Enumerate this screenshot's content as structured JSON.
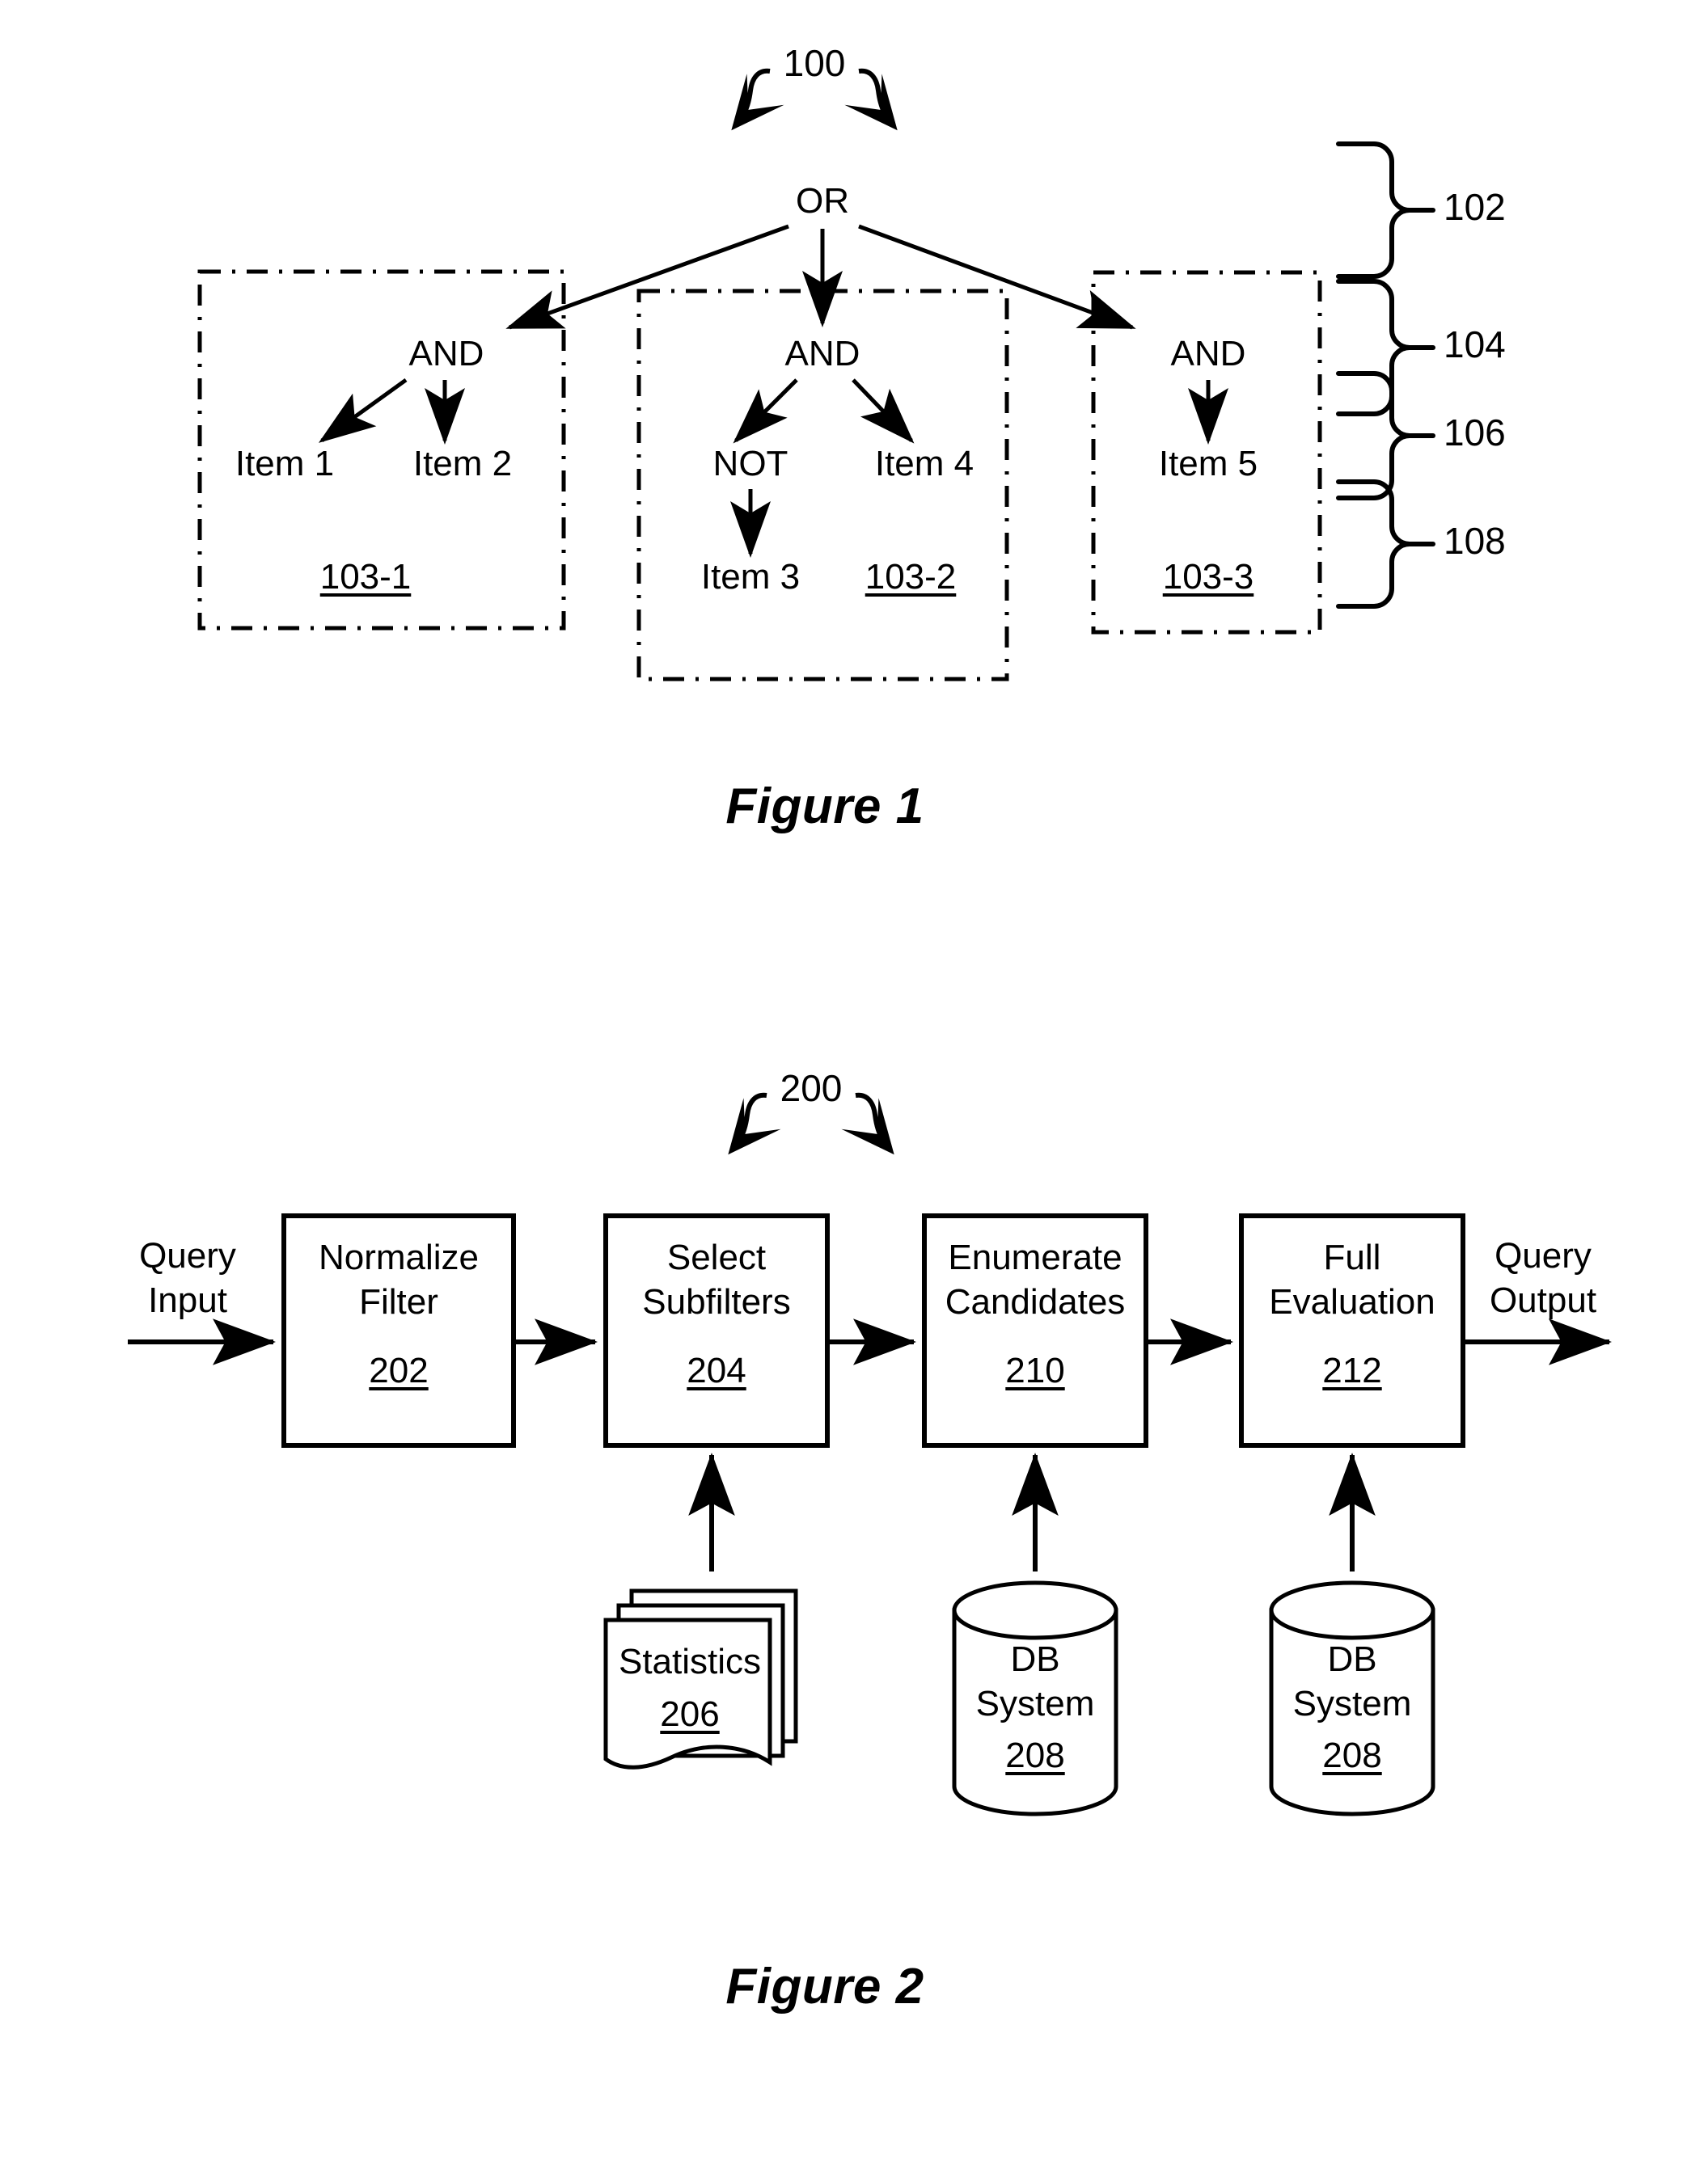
{
  "figure1": {
    "ref": "100",
    "caption": "Figure 1",
    "tree": {
      "root": "OR",
      "operators": [
        "AND",
        "AND",
        "AND"
      ],
      "not_label": "NOT",
      "leaves": [
        "Item 1",
        "Item 2",
        "Item 3",
        "Item 4",
        "Item 5"
      ]
    },
    "group_refs": [
      "103-1",
      "103-2",
      "103-3"
    ],
    "brace_refs": [
      "102",
      "104",
      "106",
      "108"
    ]
  },
  "figure2": {
    "ref": "200",
    "caption": "Figure 2",
    "input_label_line1": "Query",
    "input_label_line2": "Input",
    "output_label_line1": "Query",
    "output_label_line2": "Output",
    "stages": [
      {
        "line1": "Normalize",
        "line2": "Filter",
        "ref": "202"
      },
      {
        "line1": "Select",
        "line2": "Subfilters",
        "ref": "204"
      },
      {
        "line1": "Enumerate",
        "line2": "Candidates",
        "ref": "210"
      },
      {
        "line1": "Full",
        "line2": "Evaluation",
        "ref": "212"
      }
    ],
    "sources": [
      {
        "line1": "Statistics",
        "line2": "",
        "ref": "206",
        "shape": "document-stack"
      },
      {
        "line1": "DB",
        "line2": "System",
        "ref": "208",
        "shape": "cylinder"
      },
      {
        "line1": "DB",
        "line2": "System",
        "ref": "208",
        "shape": "cylinder"
      }
    ]
  }
}
